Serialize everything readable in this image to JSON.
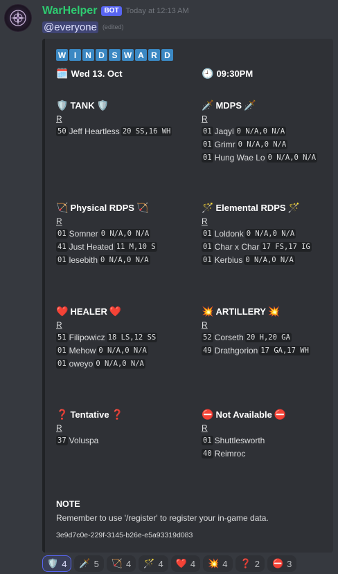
{
  "message": {
    "username": "WarHelper",
    "bot_tag": "BOT",
    "timestamp": "Today at 12:13 AM",
    "mention": "@everyone",
    "edited": "(edited)"
  },
  "embed": {
    "title_letters": [
      "W",
      "I",
      "N",
      "D",
      "S",
      "W",
      "A",
      "R",
      "D"
    ],
    "date_icon": "🗓️",
    "date": "Wed 13. Oct",
    "time_icon": "🕘",
    "time": "09:30PM",
    "roles": [
      {
        "icon": "🛡️",
        "name": "TANK",
        "r": "R",
        "members": [
          {
            "num": "50",
            "name": "Jeff Heartless",
            "stats": "20 SS,16 WH"
          }
        ]
      },
      {
        "icon": "🗡️",
        "name": "MDPS",
        "r": "R",
        "members": [
          {
            "num": "01",
            "name": "Jaqyl",
            "stats": "0 N/A,0 N/A"
          },
          {
            "num": "01",
            "name": "Grimr",
            "stats": "0 N/A,0 N/A"
          },
          {
            "num": "01",
            "name": "Hung Wae Lo",
            "stats": "0 N/A,0 N/A"
          }
        ]
      },
      {
        "icon": "🏹",
        "name": "Physical RDPS",
        "r": "R",
        "members": [
          {
            "num": "01",
            "name": "Somner",
            "stats": "0 N/A,0 N/A"
          },
          {
            "num": "41",
            "name": "Just Heated",
            "stats": "11 M,10 S"
          },
          {
            "num": "01",
            "name": "lesebith",
            "stats": "0 N/A,0 N/A"
          }
        ]
      },
      {
        "icon": "🪄",
        "name": "Elemental RDPS",
        "r": "R",
        "members": [
          {
            "num": "01",
            "name": "Loldonk",
            "stats": "0 N/A,0 N/A"
          },
          {
            "num": "01",
            "name": "Char x Char",
            "stats": "17 FS,17 IG"
          },
          {
            "num": "01",
            "name": "Kerbius",
            "stats": "0 N/A,0 N/A"
          }
        ]
      },
      {
        "icon": "❤️",
        "name": "HEALER",
        "r": "R",
        "members": [
          {
            "num": "51",
            "name": "Filipowicz",
            "stats": "18 LS,12 SS"
          },
          {
            "num": "01",
            "name": "Mehow",
            "stats": "0 N/A,0 N/A"
          },
          {
            "num": "01",
            "name": "oweyo",
            "stats": "0 N/A,0 N/A"
          }
        ]
      },
      {
        "icon": "💥",
        "name": "ARTILLERY",
        "r": "R",
        "members": [
          {
            "num": "52",
            "name": "Corseth",
            "stats": "20 H,20 GA"
          },
          {
            "num": "49",
            "name": "Drathgorion",
            "stats": "17 GA,17 WH"
          }
        ]
      },
      {
        "icon": "❓",
        "name": "Tentative",
        "r": "R",
        "members": [
          {
            "num": "37",
            "name": "Voluspa",
            "stats": ""
          }
        ]
      },
      {
        "icon": "⛔",
        "name": "Not Available",
        "r": "R",
        "members": [
          {
            "num": "01",
            "name": "Shuttlesworth",
            "stats": ""
          },
          {
            "num": "40",
            "name": "Reimroc",
            "stats": ""
          }
        ]
      }
    ],
    "note_title": "NOTE",
    "note_text": "Remember to use '/register' to register your in-game data.",
    "event_id": "3e9d7c0e-229f-3145-b26e-e5a93319d083"
  },
  "reactions": [
    {
      "icon": "🛡️",
      "count": "4",
      "active": true
    },
    {
      "icon": "🗡️",
      "count": "5",
      "active": false
    },
    {
      "icon": "🏹",
      "count": "4",
      "active": false
    },
    {
      "icon": "🪄",
      "count": "4",
      "active": false
    },
    {
      "icon": "❤️",
      "count": "4",
      "active": false
    },
    {
      "icon": "💥",
      "count": "4",
      "active": false
    },
    {
      "icon": "❓",
      "count": "2",
      "active": false
    },
    {
      "icon": "⛔",
      "count": "3",
      "active": false
    }
  ]
}
